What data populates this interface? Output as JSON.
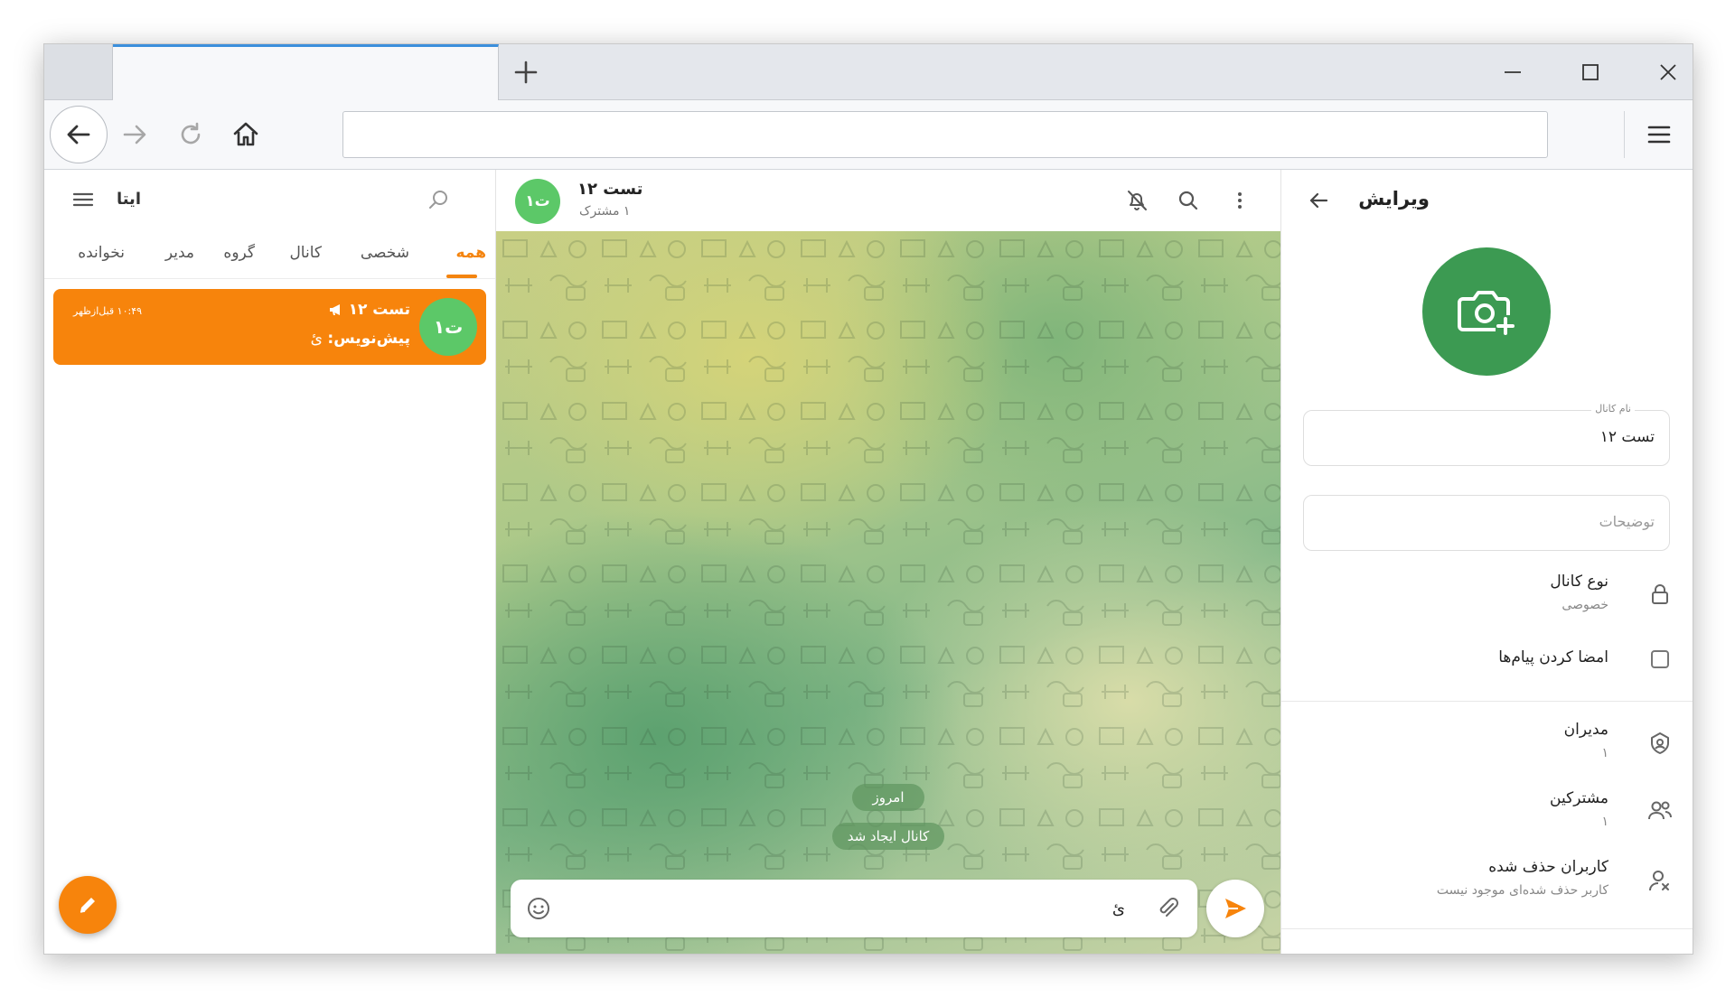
{
  "browser": {
    "new_tab_symbol": "+",
    "url": ""
  },
  "left_panel": {
    "app_title": "ایتا",
    "filters": [
      "همه",
      "شخصی",
      "کانال",
      "گروه",
      "مدیر",
      "نخوانده"
    ],
    "active_filter_index": 0,
    "chat": {
      "avatar_text": "ت۱",
      "name": "تست ۱۲",
      "draft_label": "پیش‌نویس:",
      "draft_text": "ئ",
      "time": "۱۰:۴۹ قبل‌ازظهر"
    }
  },
  "chat": {
    "avatar_text": "ت۱",
    "title": "تست ۱۲",
    "subtitle": "۱ مشترک",
    "date_pill": "امروز",
    "service_message": "کانال ایجاد شد",
    "composer_text": "ئ"
  },
  "edit_panel": {
    "title": "ویرایش",
    "name_label": "نام کانال",
    "name_value": "تست ۱۲",
    "description_placeholder": "توضیحات",
    "channel_type_label": "نوع کانال",
    "channel_type_value": "خصوصی",
    "sign_messages_label": "امضا کردن پیام‌ها",
    "admins_label": "مدیران",
    "admins_count": "۱",
    "subscribers_label": "مشترکین",
    "subscribers_count": "۱",
    "removed_label": "کاربران حذف شده",
    "removed_sub": "کاربر حذف شده‌ای موجود نیست"
  },
  "colors": {
    "accent": "#f7840c",
    "avatar_green": "#5cc868",
    "photo_green": "#3c9a52"
  }
}
